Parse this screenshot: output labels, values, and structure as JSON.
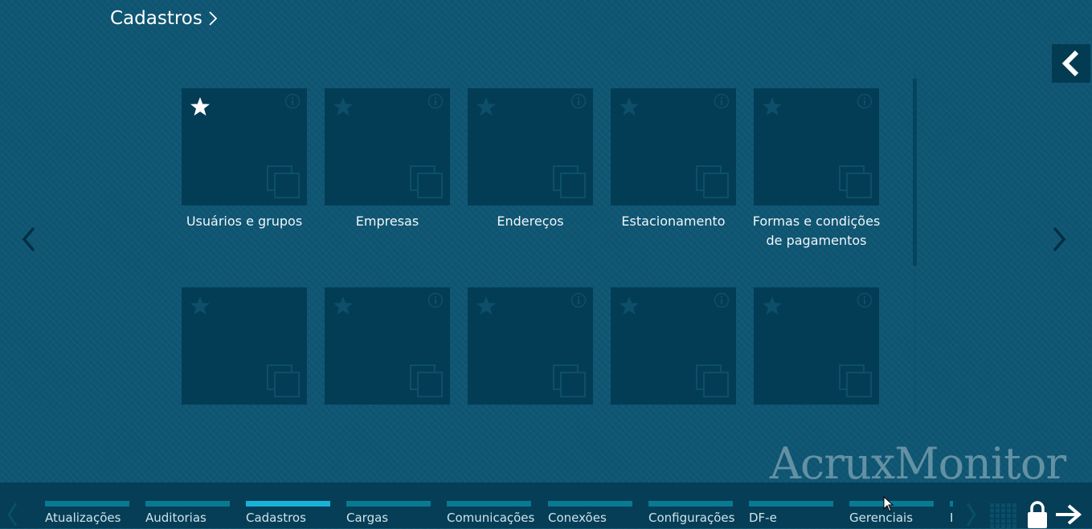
{
  "header": {
    "title": "Cadastros"
  },
  "colors": {
    "background": "#0e5673",
    "tile": "#033d55",
    "bottom_bar": "#053e56",
    "tab_bar": "#0a7a93",
    "tab_bar_active": "#19b2d6"
  },
  "tiles": [
    {
      "label": "Usuários e grupos",
      "favorite": true,
      "has_info": true
    },
    {
      "label": "Empresas",
      "favorite": false,
      "has_info": true
    },
    {
      "label": "Endereços",
      "favorite": false,
      "has_info": true
    },
    {
      "label": "Estacionamento",
      "favorite": false,
      "has_info": true
    },
    {
      "label": "Formas e condições de pagamentos",
      "favorite": false,
      "has_info": true
    },
    {
      "label": "",
      "favorite": false,
      "has_info": false
    },
    {
      "label": "",
      "favorite": false,
      "has_info": true
    },
    {
      "label": "",
      "favorite": false,
      "has_info": true
    },
    {
      "label": "",
      "favorite": false,
      "has_info": true
    },
    {
      "label": "",
      "favorite": false,
      "has_info": true
    }
  ],
  "brand": {
    "text": "AcruxMonitor"
  },
  "bottom_tabs": [
    {
      "label": "Atualizações",
      "active": false
    },
    {
      "label": "Auditorias",
      "active": false
    },
    {
      "label": "Cadastros",
      "active": true
    },
    {
      "label": "Cargas",
      "active": false
    },
    {
      "label": "Comunicações",
      "active": false
    },
    {
      "label": "Conexões",
      "active": false
    },
    {
      "label": "Configurações",
      "active": false
    },
    {
      "label": "DF-e",
      "active": false
    },
    {
      "label": "Gerenciais",
      "active": false
    },
    {
      "label": "I",
      "active": false
    }
  ],
  "icons": {
    "title_chevron": "chevron-right-icon",
    "collapse": "chevron-left-icon",
    "favorite": "star-icon",
    "info": "info-icon",
    "open": "windows-icon",
    "apps": "grid-icon",
    "lock": "lock-icon",
    "logout": "arrow-right-icon"
  }
}
